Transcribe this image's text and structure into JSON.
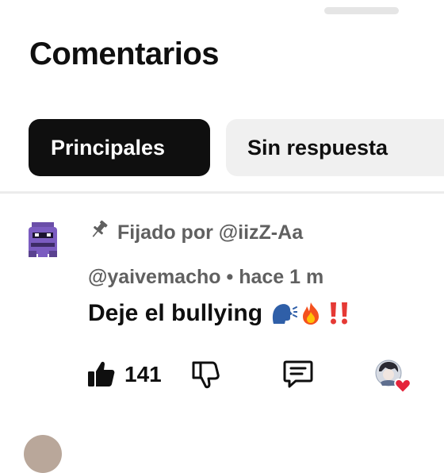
{
  "header": {
    "title": "Comentarios"
  },
  "filters": {
    "chips": [
      {
        "label": "Principales",
        "selected": true
      },
      {
        "label": "Sin respuesta",
        "selected": false
      }
    ]
  },
  "comment": {
    "pinned_label": "Fijado por @iizZ-Aa",
    "author": "@yaivemacho",
    "separator": "•",
    "time": "hace 1 m",
    "text": "Deje el bullying",
    "emojis": [
      "speaking-head-emoji",
      "fire-emoji",
      "double-exclamation-emoji"
    ],
    "likes": "141",
    "actions": {
      "like_icon": "thumbs-up-icon",
      "dislike_icon": "thumbs-down-icon",
      "reply_icon": "comment-icon",
      "creator_heart": "creator-heart-icon"
    }
  },
  "colors": {
    "chip_active_bg": "#0f0f0f",
    "chip_inactive_bg": "#f0f0f0",
    "secondary_text": "#606060",
    "heart": "#e5243b"
  }
}
